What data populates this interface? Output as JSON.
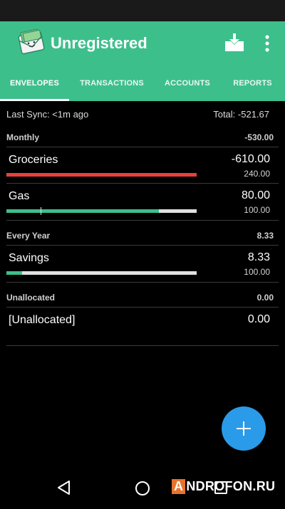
{
  "app": {
    "title": "Unregistered",
    "logo_icon": "envelope-money-icon",
    "download_icon": "download-tray-icon",
    "menu_icon": "more-vert-icon"
  },
  "tabs": [
    {
      "label": "ENVELOPES",
      "active": true
    },
    {
      "label": "TRANSACTIONS",
      "active": false
    },
    {
      "label": "ACCOUNTS",
      "active": false
    },
    {
      "label": "REPORTS",
      "active": false
    }
  ],
  "sync": {
    "last_sync": "Last Sync: <1m ago",
    "total": "Total: -521.67"
  },
  "sections": [
    {
      "label": "Monthly",
      "amount": "-530.00",
      "envelopes": [
        {
          "name": "Groceries",
          "amount": "-610.00",
          "budget": "240.00",
          "fill_fraction": 1.0,
          "fill_color": "#e8413a",
          "marker_fraction": null
        },
        {
          "name": "Gas",
          "amount": "80.00",
          "budget": "100.00",
          "fill_fraction": 0.8,
          "fill_color": "#3dbf8c",
          "marker_fraction": 0.18
        }
      ]
    },
    {
      "label": "Every Year",
      "amount": "8.33",
      "envelopes": [
        {
          "name": "Savings",
          "amount": "8.33",
          "budget": "100.00",
          "fill_fraction": 0.0833,
          "fill_color": "#3dbf8c",
          "marker_fraction": null
        }
      ]
    },
    {
      "label": "Unallocated",
      "amount": "0.00",
      "envelopes": [
        {
          "name": "[Unallocated]",
          "amount": "0.00",
          "budget": null,
          "fill_fraction": null,
          "fill_color": null,
          "marker_fraction": null
        }
      ]
    }
  ],
  "fab": {
    "icon": "plus-icon",
    "color": "#2a9be8"
  },
  "nav": {
    "back_icon": "back-triangle-icon",
    "home_icon": "home-circle-icon",
    "recent_icon": "recent-square-icon"
  },
  "watermark": {
    "box_text": "A",
    "rest_text": "NDROFON.RU"
  },
  "colors": {
    "accent": "#3dbf8c",
    "overspent": "#e8413a",
    "fab": "#2a9be8",
    "background": "#000000"
  }
}
